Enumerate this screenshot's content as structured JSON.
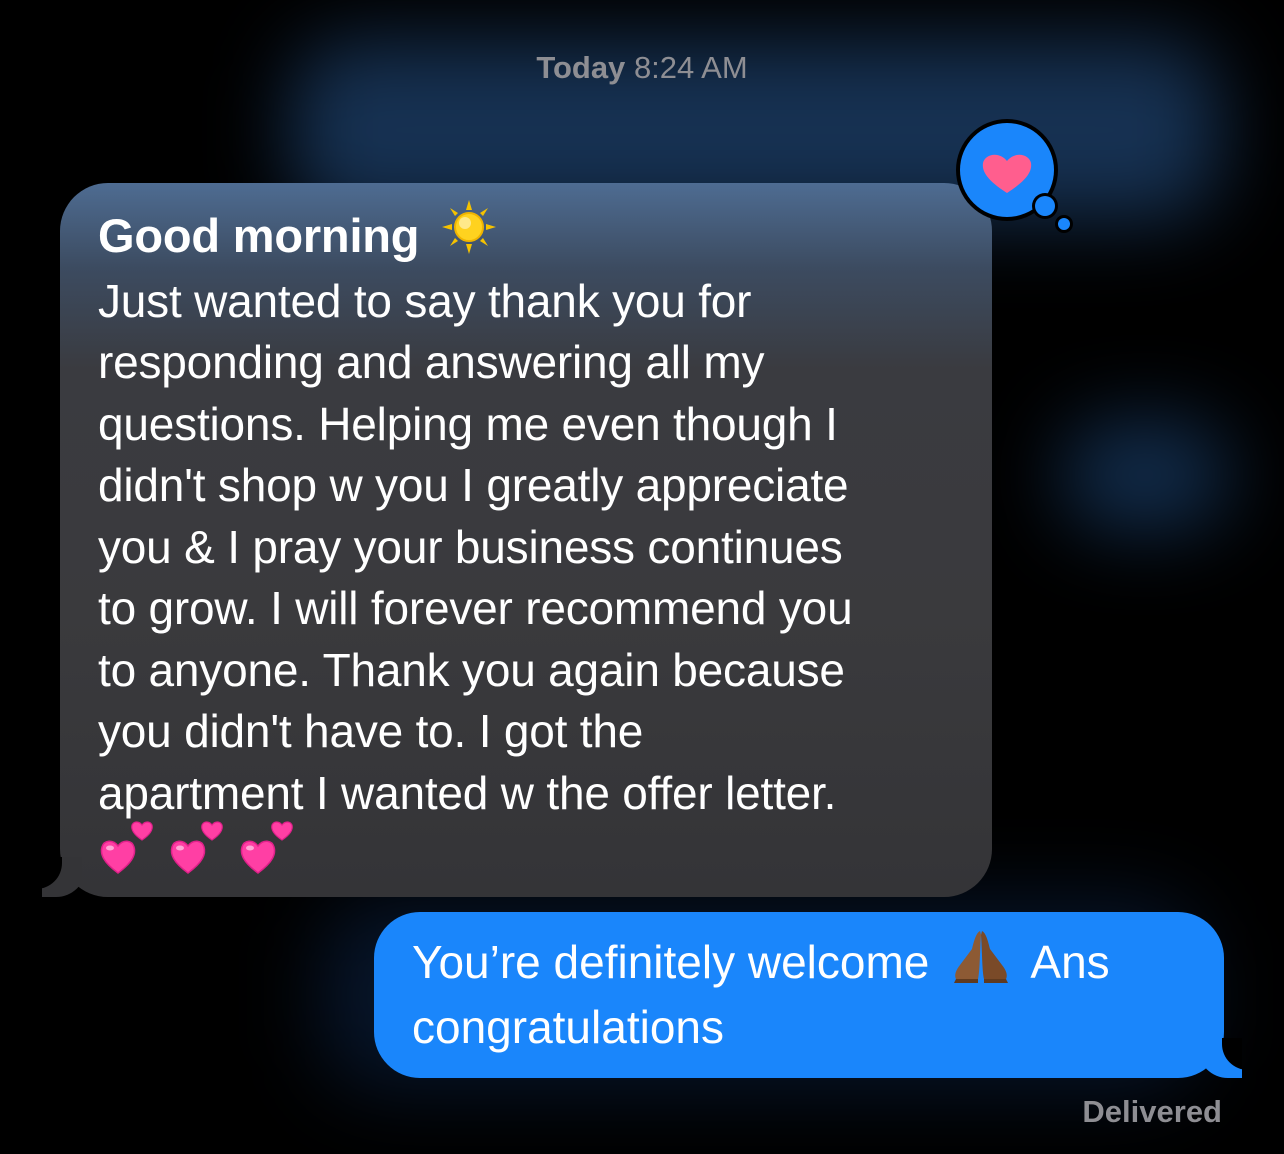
{
  "timestamp": {
    "day": "Today",
    "time": "8:24 AM"
  },
  "incoming_message": {
    "greeting": "Good morning",
    "greeting_emoji": "sun-emoji",
    "lines": [
      "Just wanted to say thank you for",
      "responding and answering all my",
      "questions. Helping me even though I",
      "didn't shop w you I greatly appreciate",
      "you & I pray your business continues",
      "to grow. I will forever recommend you",
      "to anyone. Thank you again because",
      "you didn't have to. I got the",
      "apartment I wanted w the offer letter."
    ],
    "trailing_emoji": "💕💕💕",
    "bubble_color": "#3a3a3d"
  },
  "tapback": {
    "icon": "heart-icon",
    "bubble_color": "#1a86fb",
    "heart_color": "#ff5e8e"
  },
  "outgoing_message": {
    "line1_before_emoji": "You’re definitely welcome",
    "emoji": "folded-hands-emoji",
    "line1_after_emoji": "Ans",
    "line2": "congratulations",
    "bubble_color": "#1a86fb"
  },
  "status": {
    "delivered": "Delivered"
  }
}
